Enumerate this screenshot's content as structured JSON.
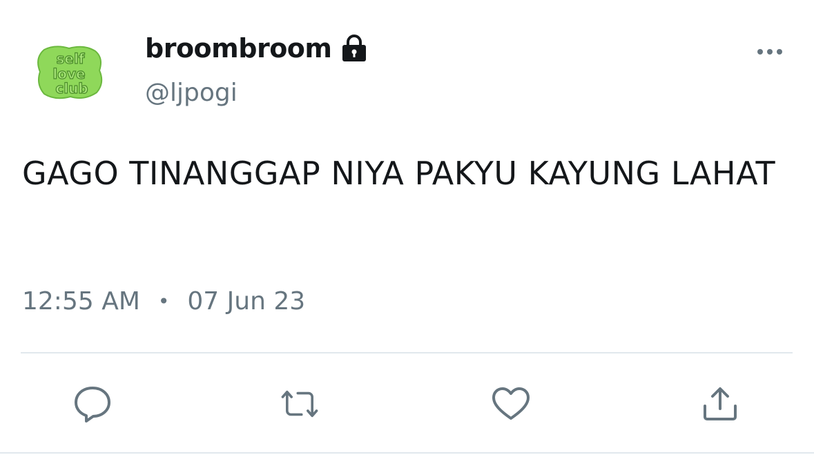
{
  "profile": {
    "display_name": "broombroom",
    "handle": "@ljpogi",
    "avatar_text": [
      "self",
      "love",
      "club"
    ],
    "protected_icon": "lock-icon"
  },
  "tweet": {
    "text": "GAGO TINANGGAP NIYA PAKYU KAYUNG LAHAT",
    "time": "12:55 AM",
    "separator": "•",
    "date": "07 Jun 23"
  },
  "actions": [
    {
      "name": "reply",
      "icon": "speech-bubble-icon"
    },
    {
      "name": "retweet",
      "icon": "retweet-icon"
    },
    {
      "name": "like",
      "icon": "heart-icon"
    },
    {
      "name": "share",
      "icon": "share-icon"
    }
  ],
  "colors": {
    "text_primary": "#14171a",
    "text_secondary": "#66757f",
    "icon_gray": "#66757f",
    "divider": "#e1e8ed",
    "avatar_green": "#8fd85a",
    "avatar_dark_green": "#4a8a2a"
  }
}
